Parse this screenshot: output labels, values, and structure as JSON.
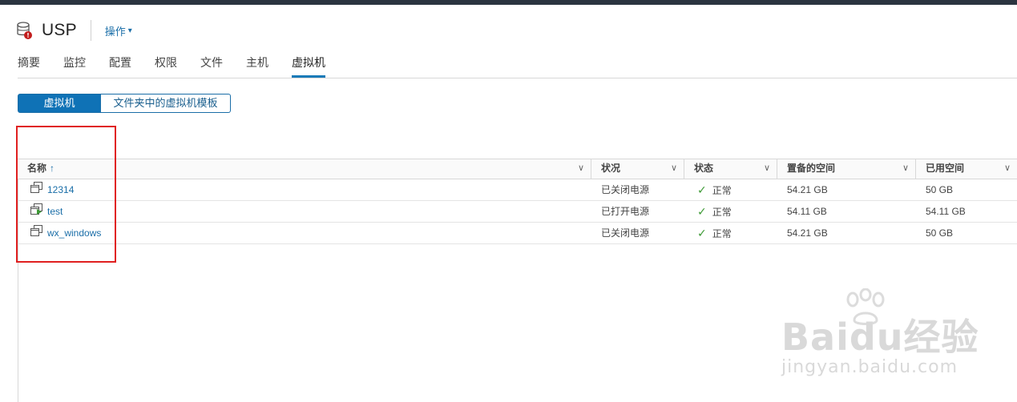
{
  "header": {
    "title": "USP",
    "actions_label": "操作",
    "actions_chevron": "⌄"
  },
  "tabs": [
    {
      "label": "摘要"
    },
    {
      "label": "监控"
    },
    {
      "label": "配置"
    },
    {
      "label": "权限"
    },
    {
      "label": "文件"
    },
    {
      "label": "主机"
    },
    {
      "label": "虚拟机",
      "active": true
    }
  ],
  "segments": {
    "vms": "虚拟机",
    "templates": "文件夹中的虚拟机模板"
  },
  "table": {
    "columns": {
      "name": "名称",
      "name_sort": "↑",
      "state": "状况",
      "status": "状态",
      "provisioned": "置备的空间",
      "used": "已用空间"
    },
    "rows": [
      {
        "name": "12314",
        "icon": "vm-powered-off-icon",
        "state": "已关闭电源",
        "status": "正常",
        "provisioned": "54.21 GB",
        "used": "50 GB"
      },
      {
        "name": "test",
        "icon": "vm-powered-on-icon",
        "state": "已打开电源",
        "status": "正常",
        "provisioned": "54.11 GB",
        "used": "54.11 GB"
      },
      {
        "name": "wx_windows",
        "icon": "vm-powered-off-icon",
        "state": "已关闭电源",
        "status": "正常",
        "provisioned": "54.21 GB",
        "used": "50 GB"
      }
    ]
  },
  "watermark": {
    "brand": "Baidu经验",
    "url": "jingyan.baidu.com"
  },
  "colors": {
    "accent": "#0f72b6",
    "link": "#1a6ea8",
    "ok": "#3d9a35",
    "annotation": "#e02020",
    "error_badge": "#c21d1d"
  }
}
